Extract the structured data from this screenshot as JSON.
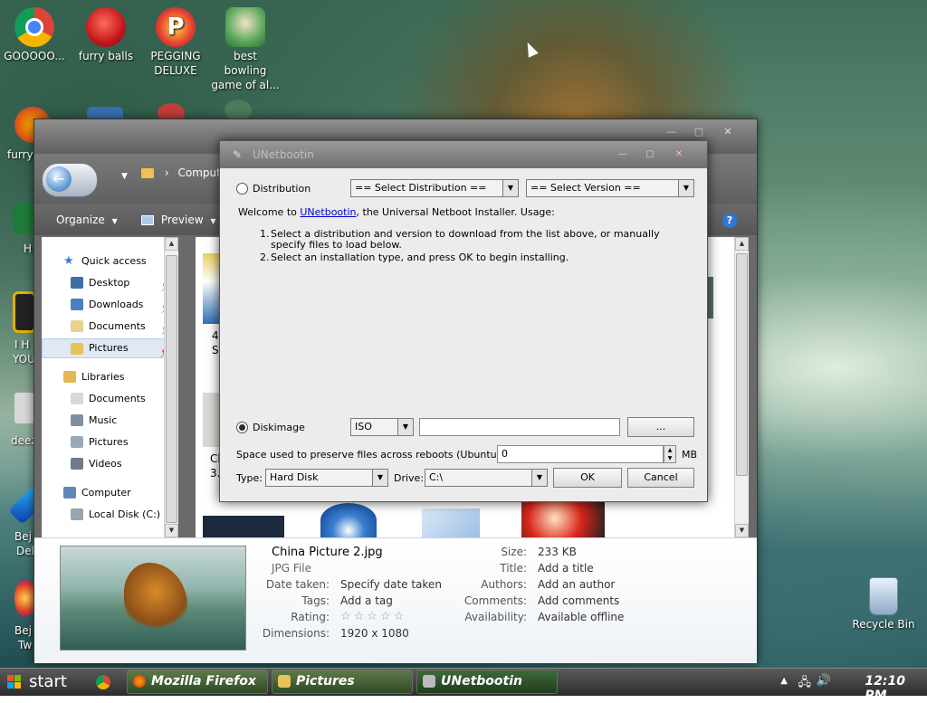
{
  "colors": {
    "explorer_chrome": "#6a6a6a",
    "link": "#0000cc",
    "taskbar": "#2c2c2c",
    "accent_blue": "#2f79d6"
  },
  "desktop": {
    "icons": [
      {
        "label": "GOOOOO...",
        "icon": "chrome-icon"
      },
      {
        "label": "furry balls",
        "icon": "furry-ball-icon"
      },
      {
        "label": "PEGGING DELUXE",
        "icon": "pegging-icon"
      },
      {
        "label": "best bowling game of al...",
        "icon": "bowling-icon"
      }
    ],
    "edge_labels": [
      "furry",
      "H",
      "I H",
      "YOU",
      "deez",
      "Bej",
      "Del",
      "Bej",
      "Tw"
    ],
    "recycle_bin": "Recycle Bin"
  },
  "explorer": {
    "breadcrumb": "Computer",
    "toolbar": {
      "organize": "Organize",
      "preview": "Preview"
    },
    "nav": {
      "quick_access": "Quick access",
      "quick_items": [
        "Desktop",
        "Downloads",
        "Documents",
        "Pictures"
      ],
      "libraries": "Libraries",
      "library_items": [
        "Documents",
        "Music",
        "Pictures",
        "Videos"
      ],
      "computer": "Computer",
      "local_disk": "Local Disk (C:)"
    },
    "file_partial_labels": [
      "4",
      "S",
      "Ch",
      "3."
    ],
    "details": {
      "name": "China Picture 2.jpg",
      "type": "JPG File",
      "date_taken_label": "Date taken:",
      "date_taken_value": "Specify date taken",
      "tags_label": "Tags:",
      "tags_value": "Add a tag",
      "rating_label": "Rating:",
      "rating_stars": "☆☆☆☆☆",
      "dimensions_label": "Dimensions:",
      "dimensions_value": "1920 x 1080",
      "size_label": "Size:",
      "size_value": "233 KB",
      "title_label": "Title:",
      "title_value": "Add a title",
      "authors_label": "Authors:",
      "authors_value": "Add an author",
      "comments_label": "Comments:",
      "comments_value": "Add comments",
      "availability_label": "Availability:",
      "availability_value": "Available offline"
    }
  },
  "dialog": {
    "title": "UNetbootin",
    "distribution_label": "Distribution",
    "select_distribution": "== Select Distribution ==",
    "select_version": "== Select Version ==",
    "welcome_prefix": "Welcome to ",
    "welcome_link": "UNetbootin",
    "welcome_suffix": ", the Universal Netboot Installer. Usage:",
    "steps": [
      "Select a distribution and version to download from the list above, or manually specify files to load below.",
      "Select an installation type, and press OK to begin installing."
    ],
    "diskimage_label": "Diskimage",
    "diskimage_type": "ISO",
    "diskimage_path": "",
    "browse_label": "...",
    "space_label": "Space used to preserve files across reboots (Ubuntu only):",
    "space_value": "0",
    "space_unit": "MB",
    "type_label": "Type:",
    "type_value": "Hard Disk",
    "drive_label": "Drive:",
    "drive_value": "C:\\",
    "ok_label": "OK",
    "cancel_label": "Cancel"
  },
  "taskbar": {
    "start_label": "start",
    "tasks": [
      {
        "label": "Mozilla Firefox",
        "icon": "firefox-icon"
      },
      {
        "label": "Pictures",
        "icon": "folder-icon"
      },
      {
        "label": "UNetbootin",
        "icon": "unetbootin-icon"
      }
    ],
    "clock": "12:10 PM"
  }
}
